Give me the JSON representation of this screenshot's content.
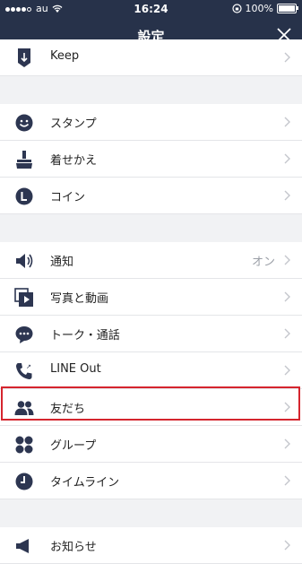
{
  "status_bar": {
    "carrier": "au",
    "time": "16:24",
    "battery": "100%"
  },
  "nav": {
    "title": "設定"
  },
  "items": [
    {
      "label": "Keep"
    },
    {
      "label": "スタンプ"
    },
    {
      "label": "着せかえ"
    },
    {
      "label": "コイン"
    },
    {
      "label": "通知",
      "value": "オン"
    },
    {
      "label": "写真と動画"
    },
    {
      "label": "トーク・通話"
    },
    {
      "label": "LINE Out"
    },
    {
      "label": "友だち"
    },
    {
      "label": "グループ"
    },
    {
      "label": "タイムライン"
    },
    {
      "label": "お知らせ"
    }
  ]
}
